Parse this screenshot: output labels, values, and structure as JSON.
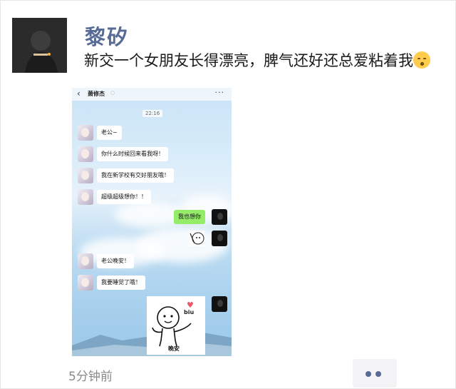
{
  "post": {
    "username": "黎矽",
    "text": "新交一个女朋友长得漂亮，脾气还好还总爱粘着我",
    "emoji": "kissing-face-icon",
    "timestamp": "5分钟前",
    "colors": {
      "name": "#576b95",
      "text": "#1a1a1a",
      "meta": "#8a8a8a"
    }
  },
  "chat_screenshot": {
    "contact_name": "萧修杰",
    "time": "22:16",
    "messages": [
      {
        "side": "left",
        "text": "老公~"
      },
      {
        "side": "left",
        "text": "你什么时候回来看我呀！"
      },
      {
        "side": "left",
        "text": "我在新学校有交好朋友哦！"
      },
      {
        "side": "left",
        "text": "超级超级想你！！"
      },
      {
        "side": "right",
        "text": "我也想你"
      },
      {
        "side": "right",
        "sticker": "peeking-sticker"
      },
      {
        "side": "left",
        "text": "老公晚安！"
      },
      {
        "side": "left",
        "text": "我要睡觉了哦！"
      },
      {
        "side": "right",
        "sticker": "biu-sticker",
        "sticker_text": "biu",
        "sticker_caption": "晚安"
      }
    ],
    "colors": {
      "sent_bubble": "#95ec69",
      "received_bubble": "#ffffff"
    }
  }
}
